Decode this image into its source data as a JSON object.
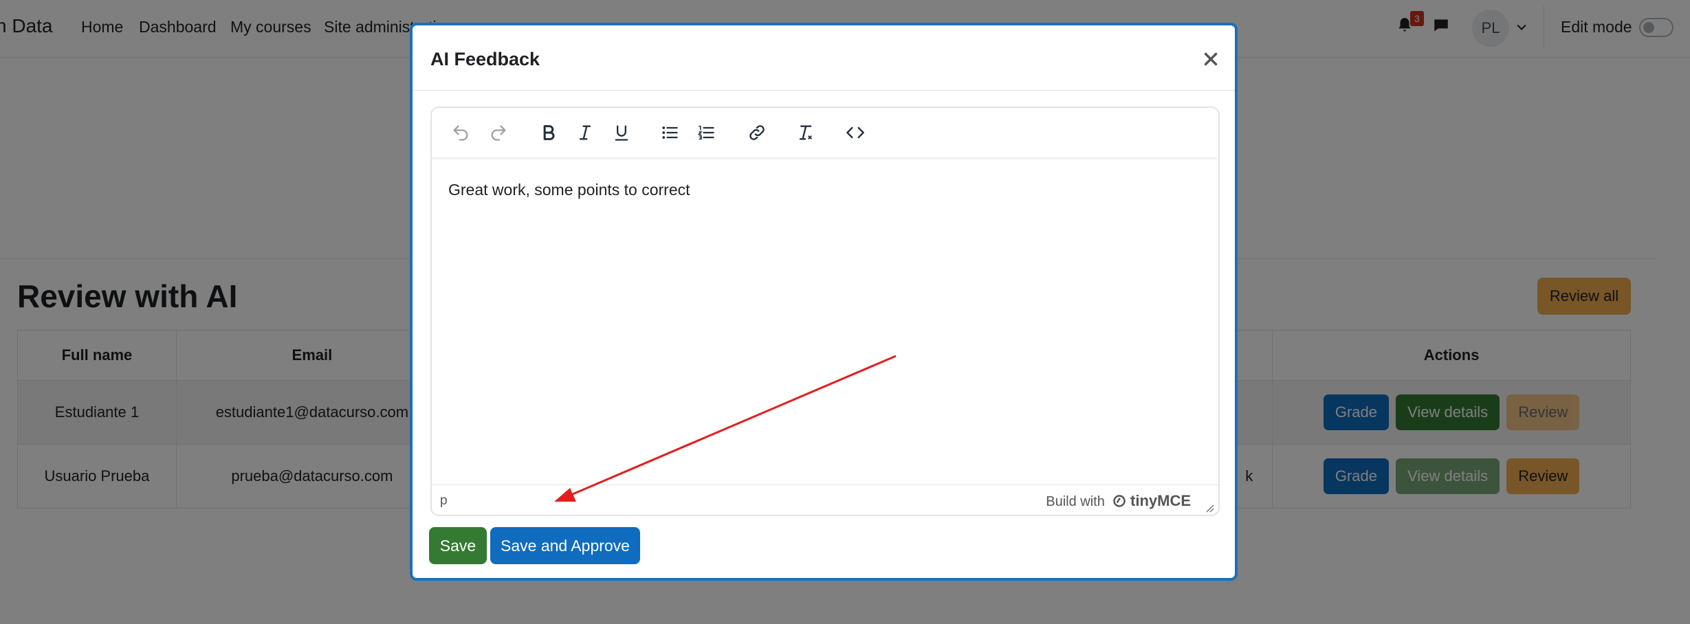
{
  "navbar": {
    "brand": "n Data",
    "links": [
      "Home",
      "Dashboard",
      "My courses",
      "Site administration"
    ],
    "notification_count": "3",
    "avatar_initials": "PL",
    "edit_mode_label": "Edit mode",
    "edit_mode_on": false
  },
  "page": {
    "title": "Review with AI",
    "review_all_label": "Review all",
    "table": {
      "headers": [
        "Full name",
        "Email",
        "Actions"
      ],
      "rows": [
        {
          "name": "Estudiante 1",
          "email": "estudiante1@datacurso.com"
        },
        {
          "name": "Usuario Prueba",
          "email": "prueba@datacurso.com",
          "partial": "k"
        }
      ],
      "action_labels": {
        "grade": "Grade",
        "view_details": "View details",
        "review": "Review"
      }
    }
  },
  "modal": {
    "title": "AI Feedback",
    "toolbar": [
      "undo-icon",
      "redo-icon",
      "bold-icon",
      "italic-icon",
      "underline-icon",
      "bullet-list-icon",
      "numbered-list-icon",
      "link-icon",
      "clear-formatting-icon",
      "source-code-icon"
    ],
    "content": "Great work, some points to correct",
    "status_path": "p",
    "branding_prefix": "Build with",
    "branding_name": "tinyMCE",
    "save_label": "Save",
    "save_approve_label": "Save and Approve"
  },
  "colors": {
    "primary": "#0f6cbf",
    "success": "#357a32",
    "warning": "#f0ad4e",
    "annotation_arrow": "#e02020"
  }
}
